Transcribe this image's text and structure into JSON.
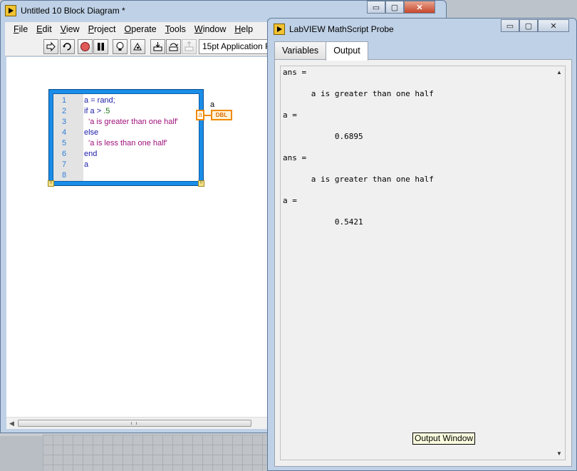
{
  "block_diagram_window": {
    "title": "Untitled 10 Block Diagram *",
    "caption_buttons": {
      "minimize": "▭",
      "maximize": "▢",
      "close": "✕"
    },
    "menu": [
      "File",
      "Edit",
      "View",
      "Project",
      "Operate",
      "Tools",
      "Window",
      "Help"
    ],
    "menu_mnemonics": [
      "F",
      "E",
      "V",
      "P",
      "O",
      "T",
      "W",
      "H"
    ],
    "toolbar": {
      "run_icon": "run-arrow-icon",
      "run_continuously_icon": "run-continuously-icon",
      "abort_icon": "abort-icon",
      "pause_icon": "pause-icon",
      "highlight_icon": "highlight-execution-icon",
      "retain_wire_icon": "retain-wire-values-icon",
      "step_into_icon": "step-into-icon",
      "step_over_icon": "step-over-icon",
      "step_out_icon": "step-out-icon",
      "font_select": "15pt Application F"
    }
  },
  "mathscript_node": {
    "lines": [
      {
        "num": "1",
        "parts": [
          {
            "text": "a = rand;",
            "kind": "plain"
          }
        ]
      },
      {
        "num": "2",
        "parts": [
          {
            "text": "if a > ",
            "kind": "kw"
          },
          {
            "text": ".5",
            "kind": "numlit"
          }
        ]
      },
      {
        "num": "3",
        "parts": [
          {
            "text": "  'a is greater than one half'",
            "kind": "str"
          }
        ]
      },
      {
        "num": "4",
        "parts": [
          {
            "text": "else",
            "kind": "kw"
          }
        ]
      },
      {
        "num": "5",
        "parts": [
          {
            "text": "  'a is less than one half'",
            "kind": "str"
          }
        ]
      },
      {
        "num": "6",
        "parts": [
          {
            "text": "end",
            "kind": "kw"
          }
        ]
      },
      {
        "num": "7",
        "parts": [
          {
            "text": "a",
            "kind": "plain"
          }
        ]
      },
      {
        "num": "8",
        "parts": [
          {
            "text": "",
            "kind": "plain"
          }
        ]
      }
    ],
    "output_terminal": "a",
    "indicator_label": "a",
    "indicator_type": "DBL"
  },
  "probe_window": {
    "title": "LabVIEW MathScript Probe",
    "caption_buttons": {
      "minimize": "▭",
      "maximize": "▢",
      "close": "✕"
    },
    "tabs": [
      {
        "label": "Variables",
        "active": false
      },
      {
        "label": "Output",
        "active": true
      }
    ],
    "output_lines": [
      "ans =",
      "      a is greater than one half",
      "a =",
      "           0.6895",
      "ans =",
      "      a is greater than one half",
      "a =",
      "           0.5421"
    ],
    "tooltip": "Output Window"
  }
}
